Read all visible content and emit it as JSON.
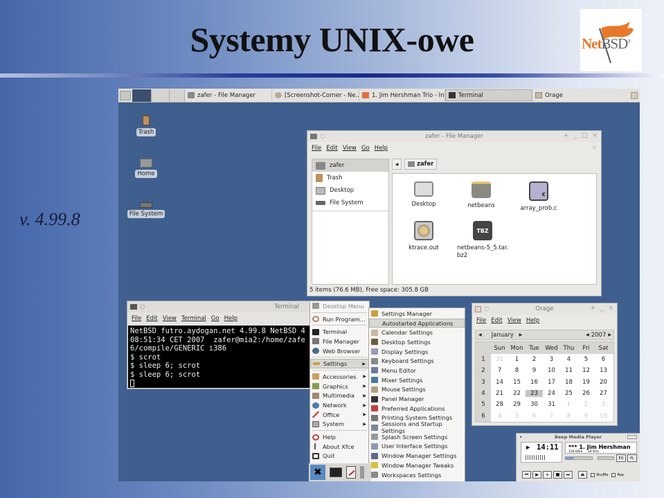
{
  "slide": {
    "title": "Systemy UNIX-owe",
    "version": "v. 4.99.8",
    "logo": {
      "word_net": "Net",
      "word_bsd": "BSD",
      "mark": "®",
      "flag_color": "#e8782a"
    }
  },
  "taskbar": {
    "tasks": [
      {
        "label": "zafer - File Manager",
        "icon": "folder-icon",
        "active": false
      },
      {
        "label": "[Screenshot-Corner - Ne...",
        "icon": "browser-icon",
        "active": false
      },
      {
        "label": "1. Jim Hershman Trio - In ...",
        "icon": "music-icon",
        "active": false
      },
      {
        "label": "Terminal",
        "icon": "terminal-icon",
        "active": true
      },
      {
        "label": "Orage",
        "icon": "calendar-icon",
        "active": false
      }
    ]
  },
  "desktop_icons": [
    {
      "label": "Trash",
      "icon": "trash-icon"
    },
    {
      "label": "Home",
      "icon": "home-folder-icon"
    },
    {
      "label": "File System",
      "icon": "drive-icon"
    }
  ],
  "file_manager": {
    "title": "zafer - File Manager",
    "menu": [
      "File",
      "Edit",
      "View",
      "Go",
      "Help"
    ],
    "sidebar": [
      {
        "label": "zafer",
        "selected": true
      },
      {
        "label": "Trash",
        "selected": false
      },
      {
        "label": "Desktop",
        "selected": false
      },
      {
        "label": "File System",
        "selected": false
      }
    ],
    "path": "zafer",
    "files": [
      {
        "name": "Desktop",
        "icon": "desktop-folder-icon"
      },
      {
        "name": "netbeans",
        "icon": "folder-icon"
      },
      {
        "name": "array_prob.c",
        "icon": "c-source-icon"
      },
      {
        "name": "ktrace.out",
        "icon": "binary-gear-icon"
      },
      {
        "name": "netbeans-5_5.tar.bz2",
        "icon": "archive-tbz-icon"
      }
    ],
    "status": "5 items (76.6 MB), Free space: 305.8 GB"
  },
  "terminal": {
    "title": "Terminal",
    "menu": [
      "File",
      "Edit",
      "View",
      "Terminal",
      "Go",
      "Help"
    ],
    "lines": [
      "NetBSD futro.aydogan.net 4.99.8 NetBSD 4",
      "08:51:34 CET 2007  zafer@mia2:/home/zafe",
      "6/compile/GENERIC i386",
      "$ scrot",
      "$ sleep 6; scrot",
      "$ sleep 6; scrot"
    ]
  },
  "desktop_menu": {
    "header": "Desktop Menu",
    "groups": [
      [
        {
          "label": "Run Program...",
          "icon": "run-icon"
        }
      ],
      [
        {
          "label": "Terminal",
          "icon": "terminal-icon"
        },
        {
          "label": "File Manager",
          "icon": "file-manager-icon"
        },
        {
          "label": "Web Browser",
          "icon": "globe-icon"
        }
      ],
      [
        {
          "label": "Settings",
          "icon": "wrench-icon",
          "submenu": true,
          "selected": true
        }
      ],
      [
        {
          "label": "Accessories",
          "icon": "accessories-icon",
          "submenu": true
        },
        {
          "label": "Graphics",
          "icon": "graphics-icon",
          "submenu": true
        },
        {
          "label": "Multimedia",
          "icon": "multimedia-icon",
          "submenu": true
        },
        {
          "label": "Network",
          "icon": "network-icon",
          "submenu": true
        },
        {
          "label": "Office",
          "icon": "office-icon",
          "submenu": true
        },
        {
          "label": "System",
          "icon": "system-icon",
          "submenu": true
        }
      ],
      [
        {
          "label": "Help",
          "icon": "help-icon"
        },
        {
          "label": "About Xfce",
          "icon": "info-icon"
        },
        {
          "label": "Quit",
          "icon": "quit-icon"
        }
      ]
    ]
  },
  "settings_menu": {
    "items": [
      {
        "label": "Settings Manager",
        "selected": false
      },
      {
        "label": "Autostarted Applications",
        "selected": true
      },
      {
        "label": "Calendar Settings",
        "selected": false
      },
      {
        "label": "Desktop Settings",
        "selected": false
      },
      {
        "label": "Display Settings",
        "selected": false
      },
      {
        "label": "Keyboard Settings",
        "selected": false
      },
      {
        "label": "Menu Editor",
        "selected": false
      },
      {
        "label": "Mixer Settings",
        "selected": false
      },
      {
        "label": "Mouse Settings",
        "selected": false
      },
      {
        "label": "Panel Manager",
        "selected": false
      },
      {
        "label": "Preferred Applications",
        "selected": false
      },
      {
        "label": "Printing System Settings",
        "selected": false
      },
      {
        "label": "Sessions and Startup Settings",
        "selected": false
      },
      {
        "label": "Splash Screen Settings",
        "selected": false
      },
      {
        "label": "User Interface Settings",
        "selected": false
      },
      {
        "label": "Window Manager Settings",
        "selected": false
      },
      {
        "label": "Window Manager Tweaks",
        "selected": false
      },
      {
        "label": "Workspaces Settings",
        "selected": false
      }
    ]
  },
  "orage": {
    "title": "Orage",
    "menu": [
      "File",
      "Edit",
      "View",
      "Help"
    ],
    "month": "January",
    "year": "2007",
    "weekdays": [
      "Sun",
      "Mon",
      "Tue",
      "Wed",
      "Thu",
      "Fri",
      "Sat"
    ],
    "weeks": [
      {
        "num": "1",
        "days": [
          "31",
          "1",
          "2",
          "3",
          "4",
          "5",
          "6"
        ],
        "dim": [
          true,
          false,
          false,
          false,
          false,
          false,
          false
        ]
      },
      {
        "num": "2",
        "days": [
          "7",
          "8",
          "9",
          "10",
          "11",
          "12",
          "13"
        ],
        "dim": [
          false,
          false,
          false,
          false,
          false,
          false,
          false
        ]
      },
      {
        "num": "3",
        "days": [
          "14",
          "15",
          "16",
          "17",
          "18",
          "19",
          "20"
        ],
        "dim": [
          false,
          false,
          false,
          false,
          false,
          false,
          false
        ]
      },
      {
        "num": "4",
        "days": [
          "21",
          "22",
          "23",
          "24",
          "25",
          "26",
          "27"
        ],
        "dim": [
          false,
          false,
          false,
          false,
          false,
          false,
          false
        ]
      },
      {
        "num": "5",
        "days": [
          "28",
          "29",
          "30",
          "31",
          "1",
          "2",
          "3"
        ],
        "dim": [
          false,
          false,
          false,
          false,
          true,
          true,
          true
        ]
      },
      {
        "num": "6",
        "days": [
          "4",
          "5",
          "6",
          "7",
          "8",
          "9",
          "10"
        ],
        "dim": [
          true,
          true,
          true,
          true,
          true,
          true,
          true
        ]
      }
    ],
    "selected_day": "23"
  },
  "beep": {
    "title": "Beep Media Player",
    "time": "14:11",
    "track": "*** 1. Jim Hershman",
    "bitrate": "128 KB/S",
    "samplerate": "44 KHz",
    "eq": "EQ",
    "pl": "PL",
    "shuffle": "Shuffle",
    "repeat": "Rep",
    "volume": 0.3,
    "balance": 0.5
  }
}
